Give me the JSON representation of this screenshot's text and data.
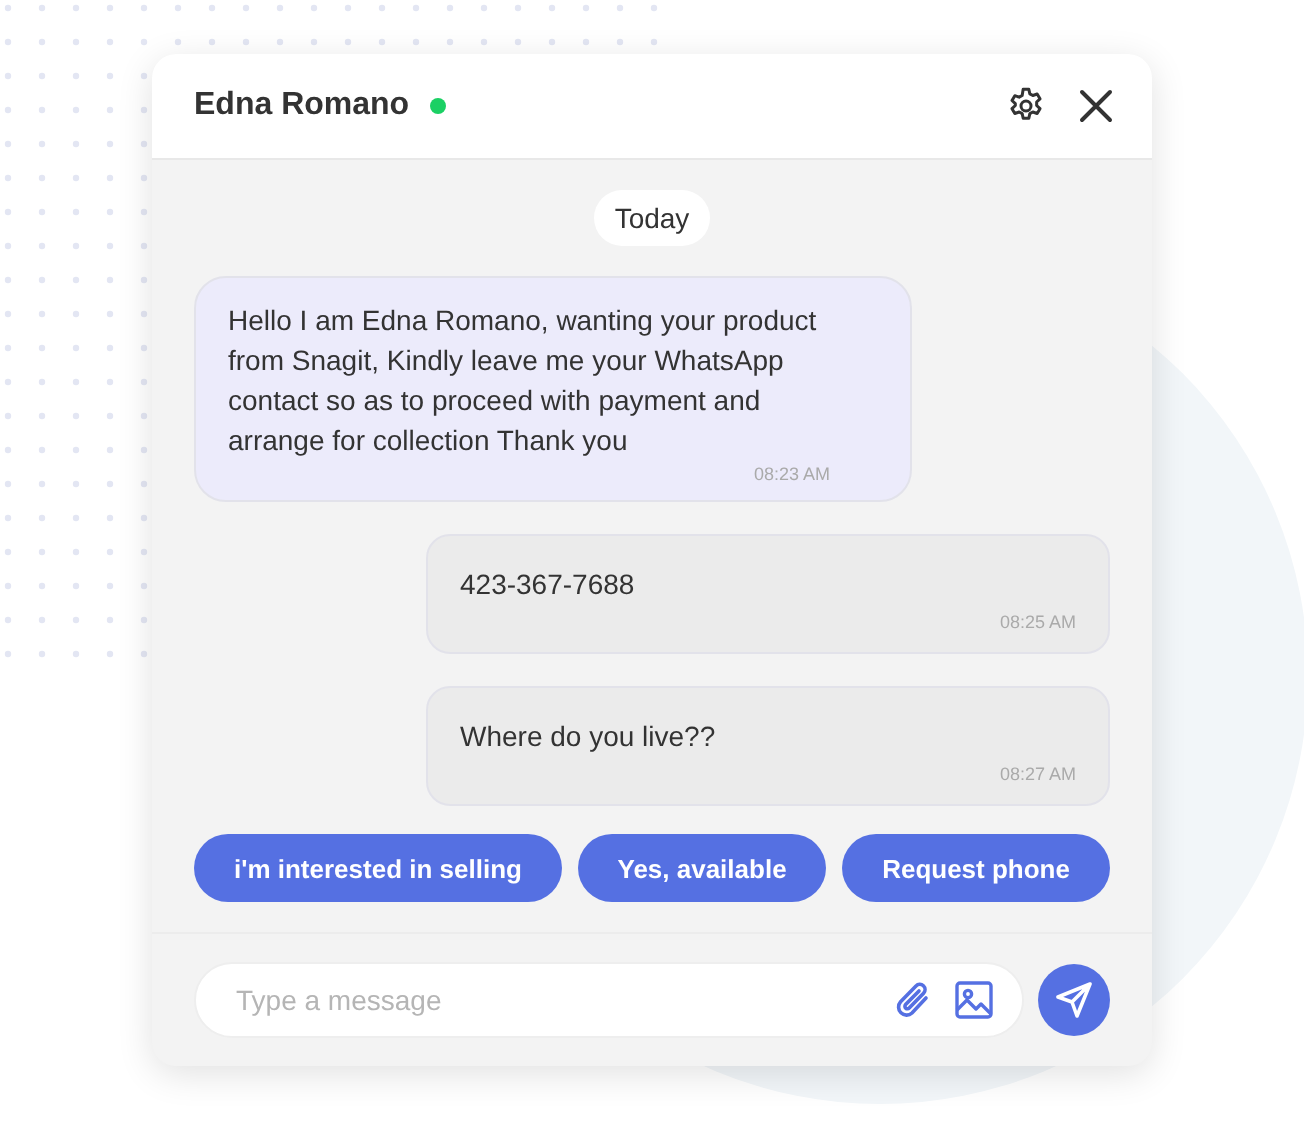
{
  "contact": {
    "name": "Edna Romano",
    "online": true
  },
  "date_label": "Today",
  "messages": [
    {
      "kind": "incoming",
      "text": "Hello I am Edna Romano, wanting your product from Snagit, Kindly leave me your WhatsApp contact so as to proceed with payment and arrange for collection Thank you",
      "time": "08:23 AM"
    },
    {
      "kind": "outgoing",
      "text": "423-367-7688",
      "time": "08:25 AM"
    },
    {
      "kind": "outgoing",
      "text": "Where do you live??",
      "time": "08:27 AM"
    }
  ],
  "quick_replies": [
    "i'm interested in selling",
    "Yes, available",
    "Request phone"
  ],
  "composer": {
    "placeholder": "Type a message"
  }
}
